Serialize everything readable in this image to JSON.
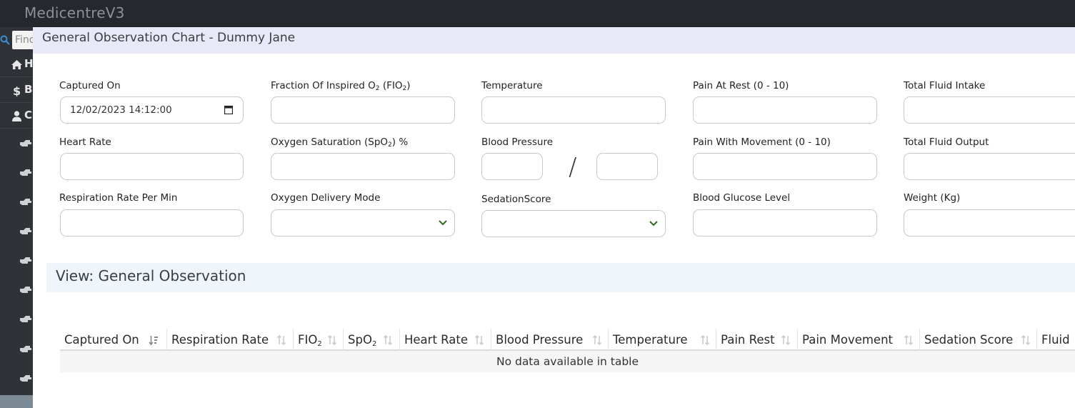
{
  "app": {
    "title": "MedicentreV3"
  },
  "sidebar": {
    "search_placeholder": "Find",
    "items": [
      {
        "icon": "home-icon",
        "label": "Home"
      },
      {
        "icon": "dollar-icon",
        "label": "Billing"
      },
      {
        "icon": "user-icon",
        "label": "Clinical"
      }
    ],
    "sub_icon": "hand-point-right-icon"
  },
  "modal": {
    "title": "General Observation Chart - Dummy Jane",
    "form": {
      "captured_on": {
        "label": "Captured On",
        "value": "12/02/2023 14:12:00"
      },
      "fio2": {
        "label_prefix": "Fraction Of Inspired O",
        "label_sub": "2",
        "label_mid": " (FIO",
        "label_sub2": "2",
        "label_suffix": ")"
      },
      "temperature": {
        "label": "Temperature"
      },
      "pain_rest": {
        "label": "Pain At Rest (0 - 10)"
      },
      "fluid_intake": {
        "label": "Total Fluid Intake"
      },
      "heart_rate": {
        "label": "Heart Rate"
      },
      "spo2": {
        "label_prefix": "Oxygen Saturation (SpO",
        "label_sub": "2",
        "label_suffix": ") %"
      },
      "blood_pressure": {
        "label": "Blood Pressure",
        "separator": "/"
      },
      "pain_movement": {
        "label": "Pain With Movement (0 - 10)"
      },
      "fluid_output": {
        "label": "Total Fluid Output"
      },
      "respiration_rate": {
        "label": "Respiration Rate Per Min"
      },
      "oxygen_delivery": {
        "label": "Oxygen Delivery Mode"
      },
      "sedation_score": {
        "label": "SedationScore"
      },
      "blood_glucose": {
        "label": "Blood Glucose Level"
      },
      "weight": {
        "label": "Weight (Kg)"
      }
    },
    "view": {
      "title": "View: General Observation",
      "columns": {
        "captured_on": "Captured On",
        "respiration_rate": "Respiration Rate",
        "fio2_prefix": "FIO",
        "fio2_sub": "2",
        "spo2_prefix": "SpO",
        "spo2_sub": "2",
        "heart_rate": "Heart Rate",
        "blood_pressure": "Blood Pressure",
        "temperature": "Temperature",
        "pain_rest": "Pain Rest",
        "pain_movement": "Pain Movement",
        "sedation_score": "Sedation Score",
        "fluid": "Fluid"
      },
      "empty_message": "No data available in table"
    }
  },
  "colors": {
    "topbar": "#25282c",
    "sidebar": "#2f3338",
    "modal_header": "#e7e9f6",
    "view_panel": "#eef5fb",
    "select_chevron": "#2e6b1f"
  }
}
